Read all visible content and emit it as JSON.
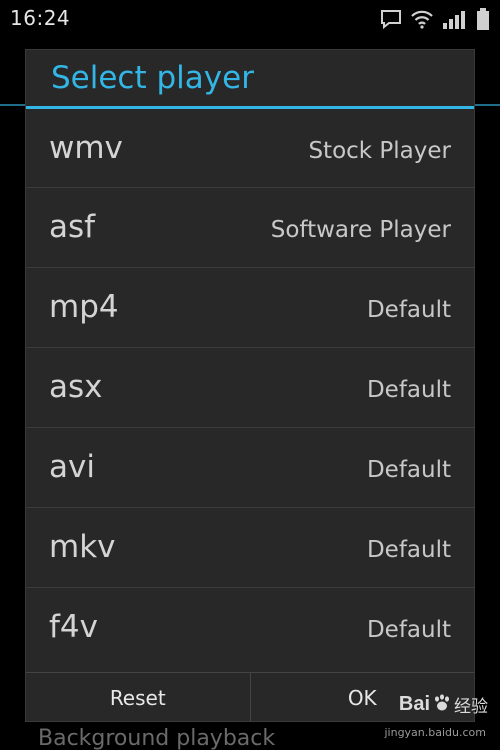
{
  "status_bar": {
    "time": "16:24",
    "icons": [
      "chat-icon",
      "wifi-icon",
      "signal-icon",
      "battery-icon"
    ]
  },
  "background": {
    "partial_text": "Background playback"
  },
  "dialog": {
    "title": "Select player",
    "accent_color": "#33b5e5",
    "items": [
      {
        "format": "wmv",
        "player": "Stock Player"
      },
      {
        "format": "asf",
        "player": "Software Player"
      },
      {
        "format": "mp4",
        "player": "Default"
      },
      {
        "format": "asx",
        "player": "Default"
      },
      {
        "format": "avi",
        "player": "Default"
      },
      {
        "format": "mkv",
        "player": "Default"
      },
      {
        "format": "f4v",
        "player": "Default"
      }
    ],
    "buttons": {
      "reset": "Reset",
      "ok": "OK"
    }
  },
  "watermark": {
    "logo": "Bai",
    "text": "经验",
    "url": "jingyan.baidu.com"
  }
}
